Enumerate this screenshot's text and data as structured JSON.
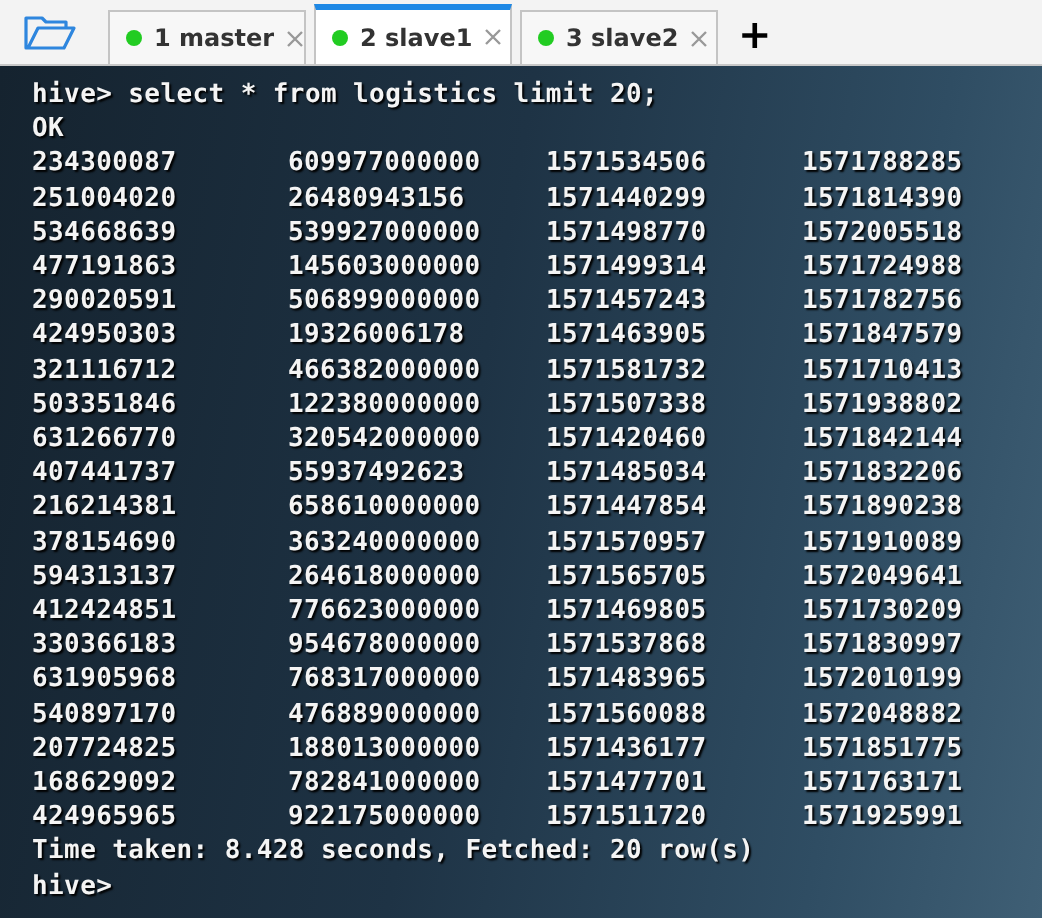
{
  "tabs": [
    {
      "label": "1 master",
      "selected": false,
      "connected": true
    },
    {
      "label": "2 slave1",
      "selected": true,
      "connected": true
    },
    {
      "label": "3 slave2",
      "selected": false,
      "connected": true
    }
  ],
  "add_tab": "+",
  "terminal": {
    "command_line": "hive> select * from logistics limit 20;",
    "status": "OK",
    "rows": [
      [
        "234300087",
        "609977000000",
        "1571534506",
        "1571788285"
      ],
      [
        "251004020",
        "26480943156",
        "1571440299",
        "1571814390"
      ],
      [
        "534668639",
        "539927000000",
        "1571498770",
        "1572005518"
      ],
      [
        "477191863",
        "145603000000",
        "1571499314",
        "1571724988"
      ],
      [
        "290020591",
        "506899000000",
        "1571457243",
        "1571782756"
      ],
      [
        "424950303",
        "19326006178",
        "1571463905",
        "1571847579"
      ],
      [
        "321116712",
        "466382000000",
        "1571581732",
        "1571710413"
      ],
      [
        "503351846",
        "122380000000",
        "1571507338",
        "1571938802"
      ],
      [
        "631266770",
        "320542000000",
        "1571420460",
        "1571842144"
      ],
      [
        "407441737",
        "55937492623",
        "1571485034",
        "1571832206"
      ],
      [
        "216214381",
        "658610000000",
        "1571447854",
        "1571890238"
      ],
      [
        "378154690",
        "363240000000",
        "1571570957",
        "1571910089"
      ],
      [
        "594313137",
        "264618000000",
        "1571565705",
        "1572049641"
      ],
      [
        "412424851",
        "776623000000",
        "1571469805",
        "1571730209"
      ],
      [
        "330366183",
        "954678000000",
        "1571537868",
        "1571830997"
      ],
      [
        "631905968",
        "768317000000",
        "1571483965",
        "1572010199"
      ],
      [
        "540897170",
        "476889000000",
        "1571560088",
        "1572048882"
      ],
      [
        "207724825",
        "188013000000",
        "1571436177",
        "1571851775"
      ],
      [
        "168629092",
        "782841000000",
        "1571477701",
        "1571763171"
      ],
      [
        "424965965",
        "922175000000",
        "1571511720",
        "1571925991"
      ]
    ],
    "summary": "Time taken: 8.428 seconds, Fetched: 20 row(s)",
    "prompt": "hive>"
  }
}
